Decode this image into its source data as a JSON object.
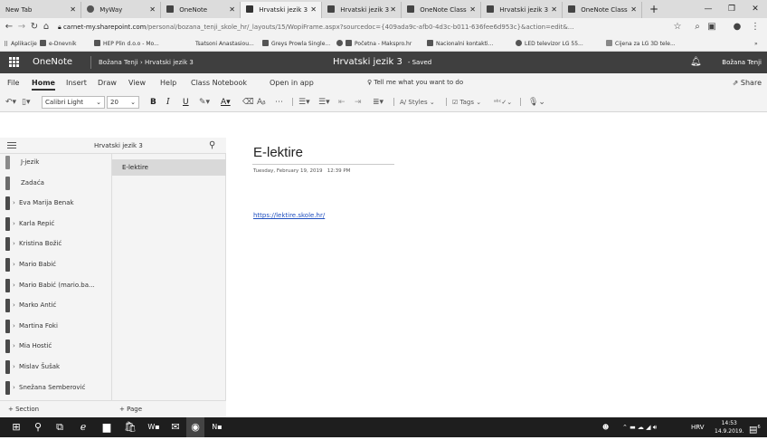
{
  "browser": {
    "tabs": [
      {
        "label": "New Tab"
      },
      {
        "label": "MyWay"
      },
      {
        "label": "OneNote"
      },
      {
        "label": "Hrvatski jezik 3"
      },
      {
        "label": "Hrvatski jezik 3"
      },
      {
        "label": "OneNote Class"
      },
      {
        "label": "Hrvatski jezik 3"
      },
      {
        "label": "OneNote Class"
      }
    ],
    "url_host": "carnet-my.sharepoint.com",
    "url_path": "/personal/bozana_tenji_skole_hr/_layouts/15/WopiFrame.aspx?sourcedoc={409ada9c-afb0-4d3c-b011-636fee6d953c}&action=edit&...",
    "bookmarks": [
      {
        "label": "Aplikacije"
      },
      {
        "label": "e-Dnevnik"
      },
      {
        "label": "HEP Plin d.o.o - Mo..."
      },
      {
        "label": "Tsatsoni Anastasiou..."
      },
      {
        "label": "Greys Prowla Single..."
      },
      {
        "label": "Početna - Makspro.hr"
      },
      {
        "label": "Nacionalni kontakti..."
      },
      {
        "label": "LED televizor LG 55..."
      },
      {
        "label": "Cijena za LG 3D tele..."
      }
    ]
  },
  "app": {
    "name": "OneNote",
    "breadcrumb_user": "Božana Tenji",
    "breadcrumb_sep": "›",
    "breadcrumb_notebook": "Hrvatski jezik 3",
    "doc_title": "Hrvatski jezik 3",
    "doc_status": "-  Saved",
    "user_name": "Božana Tenji"
  },
  "ribbon": {
    "tabs": [
      "File",
      "Home",
      "Insert",
      "Draw",
      "View",
      "Help",
      "Class Notebook",
      "Open in app"
    ],
    "tell_me": "Tell me what you want to do",
    "share": "Share",
    "font_name": "Calibri Light",
    "font_size": "20",
    "styles": "Styles",
    "tags": "Tags"
  },
  "sidebar": {
    "notebook": "Hrvatski jezik 3",
    "sections": [
      {
        "label": "J-jezik",
        "color": "#8a8a8a",
        "caret": ""
      },
      {
        "label": "Zadaća",
        "color": "#6a6a6a",
        "caret": ""
      },
      {
        "label": "Eva Marija Benak",
        "color": "#4a4a4a",
        "caret": "›"
      },
      {
        "label": "Karla Repić",
        "color": "#4a4a4a",
        "caret": "›"
      },
      {
        "label": "Kristina Božić",
        "color": "#4a4a4a",
        "caret": "›"
      },
      {
        "label": "Mario Babić",
        "color": "#4a4a4a",
        "caret": "›"
      },
      {
        "label": "Mario Babić (mario.ba...",
        "color": "#4a4a4a",
        "caret": "›"
      },
      {
        "label": "Marko Antić",
        "color": "#4a4a4a",
        "caret": "›"
      },
      {
        "label": "Martina Foki",
        "color": "#4a4a4a",
        "caret": "›"
      },
      {
        "label": "Mia Hostić",
        "color": "#4a4a4a",
        "caret": "›"
      },
      {
        "label": "Mislav Šušak",
        "color": "#4a4a4a",
        "caret": "›"
      },
      {
        "label": "Snežana Semberović",
        "color": "#4a4a4a",
        "caret": "›"
      }
    ],
    "add_section": "+ Section",
    "pages": [
      {
        "label": "E-lektire"
      }
    ],
    "add_page": "+ Page"
  },
  "page": {
    "title": "E-lektire",
    "date": "Tuesday, February 19, 2019",
    "time": "12:39 PM",
    "link": "https://lektire.skole.hr/"
  },
  "taskbar": {
    "lang": "HRV",
    "time": "14:53",
    "date": "14.9.2019.",
    "notif": "6"
  }
}
